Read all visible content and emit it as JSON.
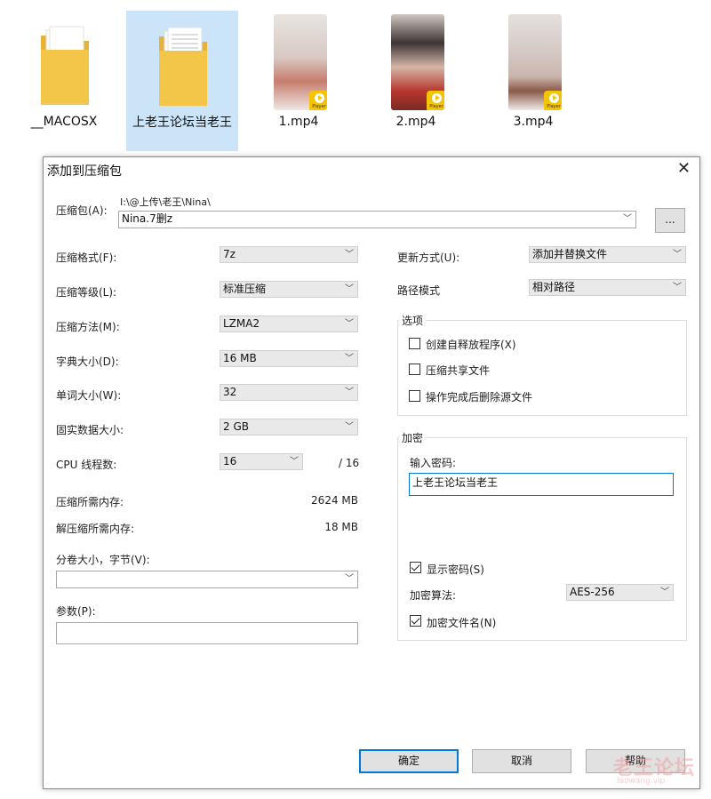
{
  "files": [
    {
      "name": "__MACOSX",
      "type": "folder"
    },
    {
      "name": "上老王论坛当老王",
      "type": "folder",
      "selected": true
    },
    {
      "name": "1.mp4",
      "type": "video"
    },
    {
      "name": "2.mp4",
      "type": "video"
    },
    {
      "name": "3.mp4",
      "type": "video"
    }
  ],
  "player_badge": "Player",
  "dialog": {
    "title": "添加到压缩包",
    "close": "✕",
    "archive_label": "压缩包(A):",
    "archive_path": "I:\\@上传\\老王\\Nina\\",
    "archive_name": "Nina.7删z",
    "browse": "...",
    "left": {
      "format_label": "压缩格式(F):",
      "format_value": "7z",
      "level_label": "压缩等级(L):",
      "level_value": "标准压缩",
      "method_label": "压缩方法(M):",
      "method_value": "LZMA2",
      "dict_label": "字典大小(D):",
      "dict_value": "16 MB",
      "word_label": "单词大小(W):",
      "word_value": "32",
      "solid_label": "固实数据大小:",
      "solid_value": "2 GB",
      "cpu_label": "CPU 线程数:",
      "cpu_value": "16",
      "cpu_total": "/ 16",
      "mem_compress_label": "压缩所需内存:",
      "mem_compress_value": "2624 MB",
      "mem_decompress_label": "解压缩所需内存:",
      "mem_decompress_value": "18 MB",
      "volume_label": "分卷大小，字节(V):",
      "volume_value": "",
      "params_label": "参数(P):",
      "params_value": ""
    },
    "right": {
      "update_label": "更新方式(U):",
      "update_value": "添加并替换文件",
      "path_label": "路径模式",
      "path_value": "相对路径",
      "options_title": "选项",
      "opt_sfx": "创建自释放程序(X)",
      "opt_shared": "压缩共享文件",
      "opt_delete": "操作完成后删除源文件",
      "encrypt_title": "加密",
      "password_label": "输入密码:",
      "password_value": "上老王论坛当老王",
      "show_password": "显示密码(S)",
      "algo_label": "加密算法:",
      "algo_value": "AES-256",
      "encrypt_names": "加密文件名(N)"
    },
    "buttons": {
      "ok": "确定",
      "cancel": "取消",
      "help": "帮助"
    }
  },
  "watermark": {
    "text": "老王论坛",
    "sub": "laowang.vip"
  },
  "colors": {
    "selection": "#cce4f7",
    "accent": "#0078d7",
    "folder": "#f3c548"
  }
}
